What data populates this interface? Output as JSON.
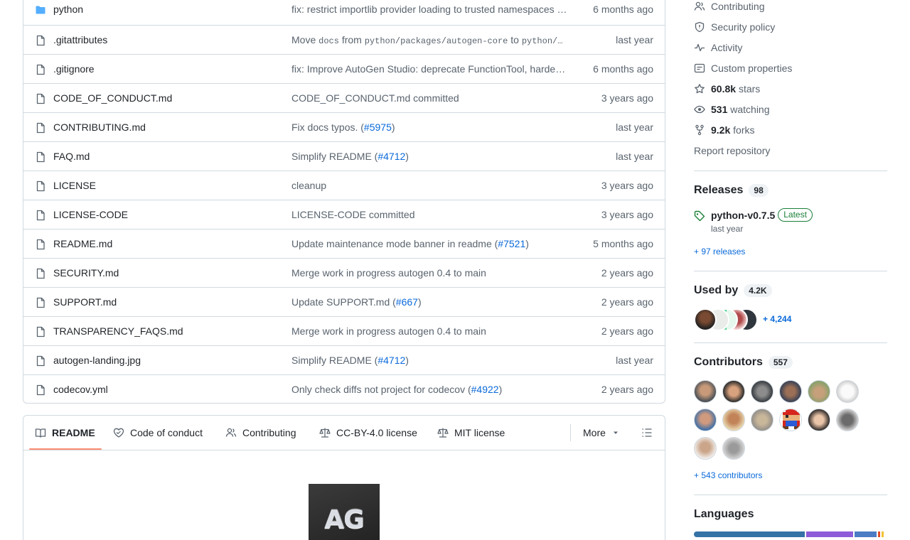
{
  "files": [
    {
      "name": "python",
      "type": "folder",
      "message": [
        {
          "t": "fix: restrict importlib provider loading to trusted namespaces …"
        }
      ],
      "time": "6 months ago"
    },
    {
      "name": ".gitattributes",
      "type": "file",
      "message": [
        {
          "t": "Move "
        },
        {
          "t": "docs",
          "code": true
        },
        {
          "t": " from "
        },
        {
          "t": "python/packages/autogen-core",
          "code": true
        },
        {
          "t": " to "
        },
        {
          "t": "python/…",
          "code": true
        }
      ],
      "time": "last year"
    },
    {
      "name": ".gitignore",
      "type": "file",
      "message": [
        {
          "t": "fix: Improve AutoGen Studio: deprecate FunctionTool, harde…"
        }
      ],
      "time": "6 months ago"
    },
    {
      "name": "CODE_OF_CONDUCT.md",
      "type": "file",
      "message": [
        {
          "t": "CODE_OF_CONDUCT.md committed"
        }
      ],
      "time": "3 years ago"
    },
    {
      "name": "CONTRIBUTING.md",
      "type": "file",
      "message": [
        {
          "t": "Fix docs typos. ("
        },
        {
          "t": "#5975",
          "link": true
        },
        {
          "t": ")"
        }
      ],
      "time": "last year"
    },
    {
      "name": "FAQ.md",
      "type": "file",
      "message": [
        {
          "t": "Simplify README ("
        },
        {
          "t": "#4712",
          "link": true
        },
        {
          "t": ")"
        }
      ],
      "time": "last year"
    },
    {
      "name": "LICENSE",
      "type": "file",
      "message": [
        {
          "t": "cleanup"
        }
      ],
      "time": "3 years ago"
    },
    {
      "name": "LICENSE-CODE",
      "type": "file",
      "message": [
        {
          "t": "LICENSE-CODE committed"
        }
      ],
      "time": "3 years ago"
    },
    {
      "name": "README.md",
      "type": "file",
      "message": [
        {
          "t": "Update maintenance mode banner in readme ("
        },
        {
          "t": "#7521",
          "link": true
        },
        {
          "t": ")"
        }
      ],
      "time": "5 months ago"
    },
    {
      "name": "SECURITY.md",
      "type": "file",
      "message": [
        {
          "t": "Merge work in progress autogen 0.4 to main"
        }
      ],
      "time": "2 years ago"
    },
    {
      "name": "SUPPORT.md",
      "type": "file",
      "message": [
        {
          "t": "Update SUPPORT.md ("
        },
        {
          "t": "#667",
          "link": true
        },
        {
          "t": ")"
        }
      ],
      "time": "2 years ago"
    },
    {
      "name": "TRANSPARENCY_FAQS.md",
      "type": "file",
      "message": [
        {
          "t": "Merge work in progress autogen 0.4 to main"
        }
      ],
      "time": "2 years ago"
    },
    {
      "name": "autogen-landing.jpg",
      "type": "file",
      "message": [
        {
          "t": "Simplify README ("
        },
        {
          "t": "#4712",
          "link": true
        },
        {
          "t": ")"
        }
      ],
      "time": "last year"
    },
    {
      "name": "codecov.yml",
      "type": "file",
      "message": [
        {
          "t": "Only check diffs not project for codecov ("
        },
        {
          "t": "#4922",
          "link": true
        },
        {
          "t": ")"
        }
      ],
      "time": "2 years ago"
    }
  ],
  "readme_tabs": {
    "readme": "README",
    "code_of_conduct": "Code of conduct",
    "contributing": "Contributing",
    "cc_license": "CC-BY-4.0 license",
    "mit_license": "MIT license",
    "more": "More"
  },
  "readme_logo_text": "AG",
  "sidebar": {
    "contributing": "Contributing",
    "security_policy": "Security policy",
    "activity": "Activity",
    "custom_properties": "Custom properties",
    "stars_count": "60.8k",
    "stars_label": "stars",
    "watching_count": "531",
    "watching_label": "watching",
    "forks_count": "9.2k",
    "forks_label": "forks",
    "report": "Report repository",
    "releases_title": "Releases",
    "releases_count": "98",
    "release_name": "python-v0.7.5",
    "release_badge": "Latest",
    "release_time": "last year",
    "more_releases": "+ 97 releases",
    "usedby_title": "Used by",
    "usedby_count": "4.2K",
    "usedby_more": "+ 4,244",
    "contributors_title": "Contributors",
    "contributors_count": "557",
    "more_contributors": "+ 543 contributors",
    "languages_title": "Languages"
  },
  "colors": {
    "link": "#0969da",
    "muted": "#59636e",
    "border": "#d1d9e0",
    "folder": "#54aeff",
    "tab_underline": "#fd8c73",
    "latest_green": "#1a7f37"
  },
  "languages_bar": [
    {
      "color": "#3572A5",
      "fraction": 0.59
    },
    {
      "color": "#8e5cd9",
      "fraction": 0.25
    },
    {
      "color": "#4b7cc4",
      "fraction": 0.12
    },
    {
      "color": "#e34c26",
      "fraction": 0.01
    },
    {
      "color": "#f1c232",
      "fraction": 0.01
    }
  ]
}
